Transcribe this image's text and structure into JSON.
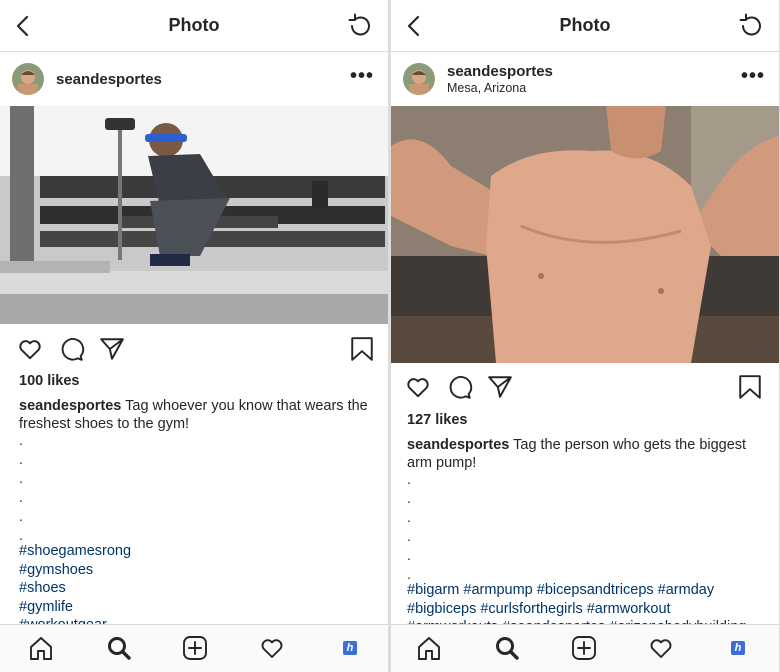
{
  "colors": {
    "hashtag": "#003569",
    "text": "#262626",
    "divider": "#dbdbdb"
  },
  "left": {
    "header": {
      "title": "Photo",
      "back_icon": "chevron-left-icon",
      "refresh_icon": "refresh-icon"
    },
    "post": {
      "username": "seandesportes",
      "more_label": "•••",
      "likes": "100 likes",
      "caption_user": "seandesportes",
      "caption_text": " Tag whoever you know that wears the freshest shoes to the gym!",
      "dots": [
        ".",
        ".",
        ".",
        ".",
        ".",
        "."
      ],
      "hashtags": [
        "#shoegamesrong",
        "#gymshoes",
        "#shoes",
        "#gymlife",
        "#workoutgear"
      ]
    },
    "tabbar": {
      "home": "home-icon",
      "search": "search-icon",
      "add": "add-post-icon",
      "activity": "heart-icon",
      "app": "h"
    }
  },
  "right": {
    "header": {
      "title": "Photo",
      "back_icon": "chevron-left-icon",
      "refresh_icon": "refresh-icon"
    },
    "post": {
      "username": "seandesportes",
      "location": "Mesa, Arizona",
      "more_label": "•••",
      "likes": "127 likes",
      "caption_user": "seandesportes",
      "caption_text": " Tag the person who gets the biggest arm pump!",
      "dots": [
        ".",
        ".",
        ".",
        ".",
        ".",
        "."
      ],
      "hashtag_lines": [
        "#bigarm #armpump #bicepsandtriceps #armday",
        "#bigbiceps #curlsforthegirls #armworkout",
        "#armworkouts #seandesportes #arizonabodybuilding"
      ]
    },
    "tabbar": {
      "home": "home-icon",
      "search": "search-icon",
      "add": "add-post-icon",
      "activity": "heart-icon",
      "app": "h"
    }
  }
}
